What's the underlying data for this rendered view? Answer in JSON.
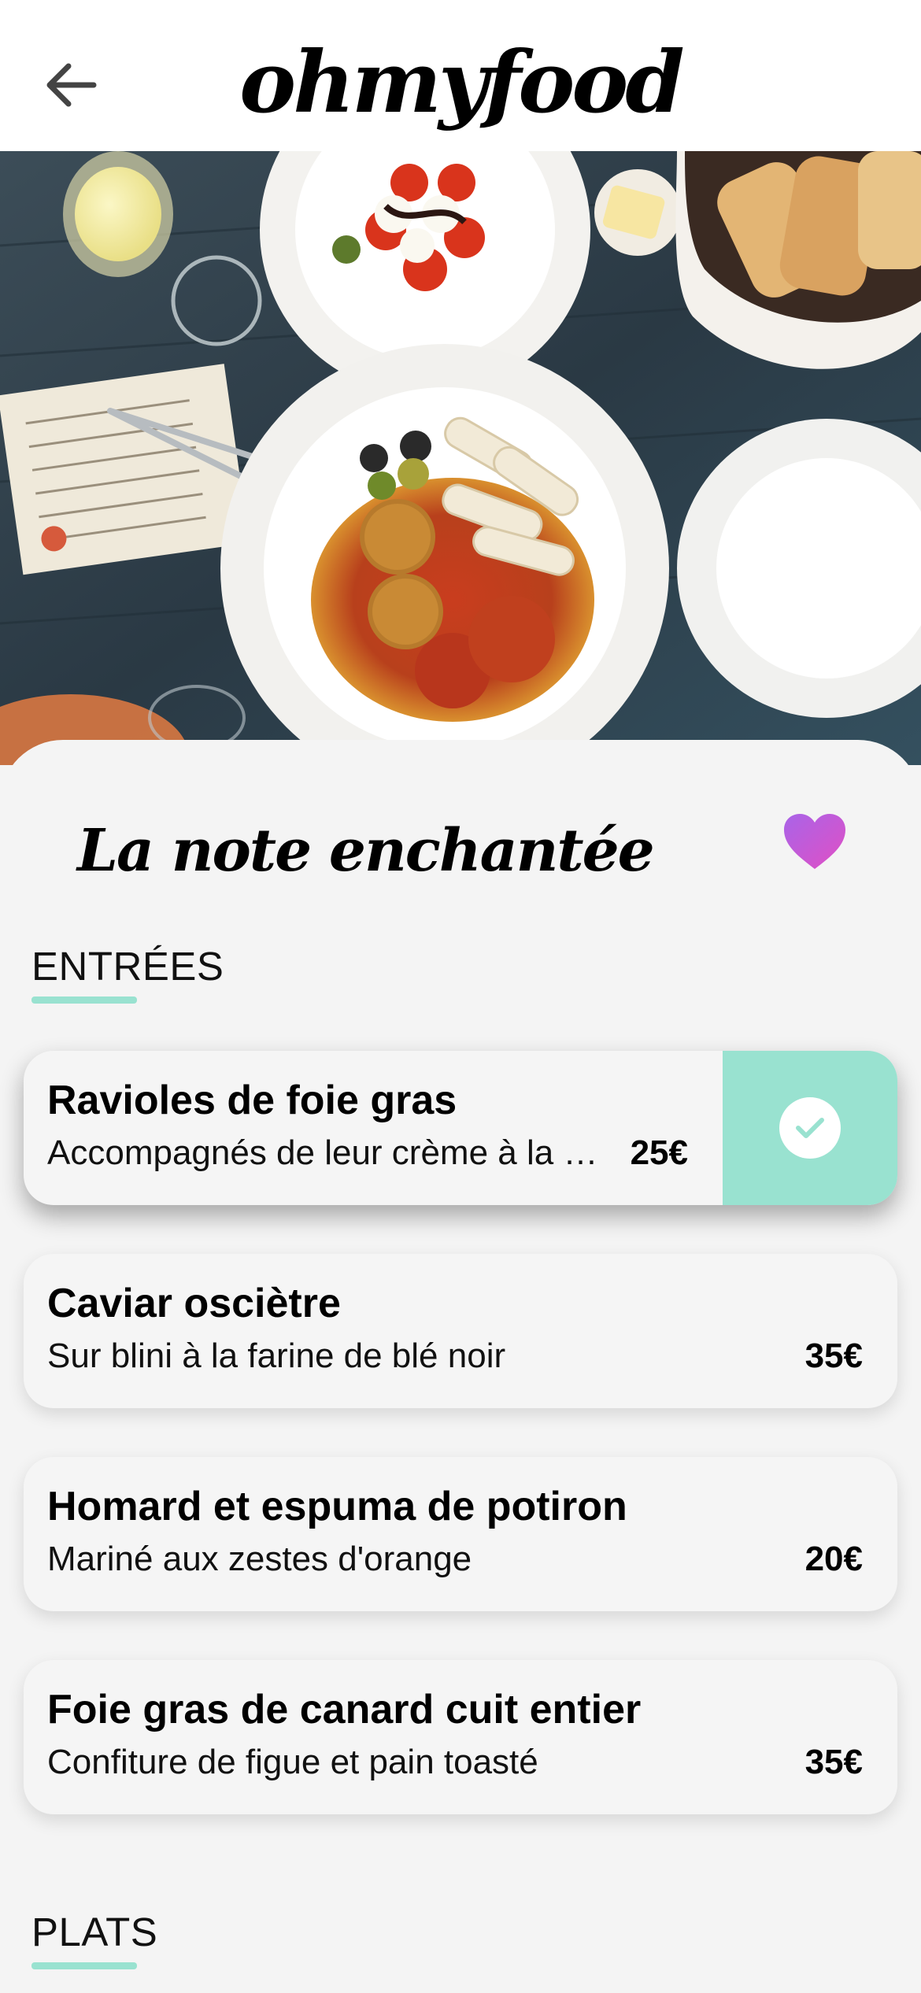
{
  "app": {
    "logo": "ohmyfood",
    "back_icon": "arrow-left-icon"
  },
  "restaurant": {
    "name": "La note enchantée",
    "favorite_icon": "heart-icon",
    "favorite_color": "#c45ad8"
  },
  "colors": {
    "accent": "#99e2d0",
    "background": "#f4f4f4"
  },
  "sections": [
    {
      "heading": "ENTRÉES",
      "items": [
        {
          "name": "Ravioles de foie gras",
          "description": "Accompagnés de leur crème à la truffe",
          "price": "25€",
          "selected": true
        },
        {
          "name": "Caviar osciètre",
          "description": "Sur blini à la farine de blé noir",
          "price": "35€",
          "selected": false
        },
        {
          "name": "Homard et espuma de potiron",
          "description": "Mariné aux zestes d'orange",
          "price": "20€",
          "selected": false
        },
        {
          "name": "Foie gras de canard cuit entier",
          "description": "Confiture de figue et pain toasté",
          "price": "35€",
          "selected": false
        }
      ]
    },
    {
      "heading": "PLATS",
      "items": []
    }
  ]
}
